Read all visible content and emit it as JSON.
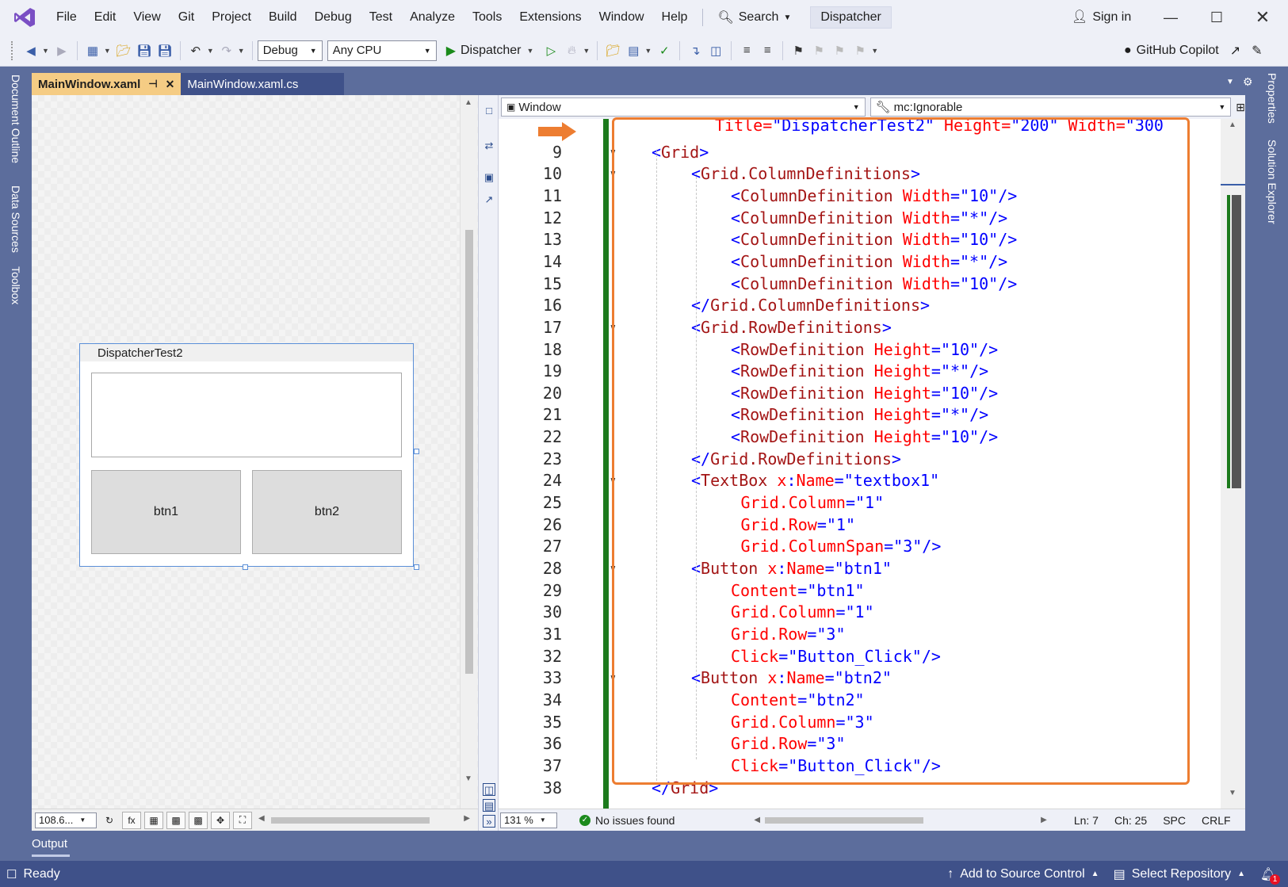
{
  "menu": {
    "items": [
      "File",
      "Edit",
      "View",
      "Git",
      "Project",
      "Build",
      "Debug",
      "Test",
      "Analyze",
      "Tools",
      "Extensions",
      "Window",
      "Help"
    ],
    "search_label": "Search",
    "solution_name": "Dispatcher",
    "sign_in": "Sign in"
  },
  "toolbar": {
    "configuration": "Debug",
    "platform": "Any CPU",
    "run_target": "Dispatcher",
    "copilot": "GitHub Copilot"
  },
  "left_rail": [
    "Document Outline",
    "Data Sources",
    "Toolbox"
  ],
  "right_rail": [
    "Properties",
    "Solution Explorer"
  ],
  "tabs": [
    {
      "label": "MainWindow.xaml",
      "active": true
    },
    {
      "label": "MainWindow.xaml.cs",
      "active": false
    }
  ],
  "designer": {
    "window_title": "DispatcherTest2",
    "buttons": [
      "btn1",
      "btn2"
    ],
    "zoom": "108.6..."
  },
  "editor": {
    "nav_left": "Window",
    "nav_right": "mc:Ignorable",
    "zoom": "131 %",
    "issues": "No issues found",
    "line": "Ln: 7",
    "col": "Ch: 25",
    "whitespace": "SPC",
    "line_ending": "CRLF",
    "first_line_text": "Title=\"DispatcherTest2\" Height=\"200\" Width=\"300",
    "lines": [
      {
        "n": "9",
        "fold": true,
        "indent": 0,
        "parts": [
          [
            "br",
            "<"
          ],
          [
            "tag",
            "Grid"
          ],
          [
            "br",
            ">"
          ]
        ]
      },
      {
        "n": "10",
        "fold": true,
        "indent": 1,
        "parts": [
          [
            "br",
            "<"
          ],
          [
            "tag",
            "Grid.ColumnDefinitions"
          ],
          [
            "br",
            ">"
          ]
        ]
      },
      {
        "n": "11",
        "fold": false,
        "indent": 2,
        "parts": [
          [
            "br",
            "<"
          ],
          [
            "tag",
            "ColumnDefinition"
          ],
          [
            "txt",
            " "
          ],
          [
            "attr",
            "Width"
          ],
          [
            "br",
            "="
          ],
          [
            "val",
            "\"10\""
          ],
          [
            "br",
            "/>"
          ]
        ]
      },
      {
        "n": "12",
        "fold": false,
        "indent": 2,
        "parts": [
          [
            "br",
            "<"
          ],
          [
            "tag",
            "ColumnDefinition"
          ],
          [
            "txt",
            " "
          ],
          [
            "attr",
            "Width"
          ],
          [
            "br",
            "="
          ],
          [
            "val",
            "\"*\""
          ],
          [
            "br",
            "/>"
          ]
        ]
      },
      {
        "n": "13",
        "fold": false,
        "indent": 2,
        "parts": [
          [
            "br",
            "<"
          ],
          [
            "tag",
            "ColumnDefinition"
          ],
          [
            "txt",
            " "
          ],
          [
            "attr",
            "Width"
          ],
          [
            "br",
            "="
          ],
          [
            "val",
            "\"10\""
          ],
          [
            "br",
            "/>"
          ]
        ]
      },
      {
        "n": "14",
        "fold": false,
        "indent": 2,
        "parts": [
          [
            "br",
            "<"
          ],
          [
            "tag",
            "ColumnDefinition"
          ],
          [
            "txt",
            " "
          ],
          [
            "attr",
            "Width"
          ],
          [
            "br",
            "="
          ],
          [
            "val",
            "\"*\""
          ],
          [
            "br",
            "/>"
          ]
        ]
      },
      {
        "n": "15",
        "fold": false,
        "indent": 2,
        "parts": [
          [
            "br",
            "<"
          ],
          [
            "tag",
            "ColumnDefinition"
          ],
          [
            "txt",
            " "
          ],
          [
            "attr",
            "Width"
          ],
          [
            "br",
            "="
          ],
          [
            "val",
            "\"10\""
          ],
          [
            "br",
            "/>"
          ]
        ]
      },
      {
        "n": "16",
        "fold": false,
        "indent": 1,
        "parts": [
          [
            "br",
            "</"
          ],
          [
            "tag",
            "Grid.ColumnDefinitions"
          ],
          [
            "br",
            ">"
          ]
        ]
      },
      {
        "n": "17",
        "fold": true,
        "indent": 1,
        "parts": [
          [
            "br",
            "<"
          ],
          [
            "tag",
            "Grid.RowDefinitions"
          ],
          [
            "br",
            ">"
          ]
        ]
      },
      {
        "n": "18",
        "fold": false,
        "indent": 2,
        "parts": [
          [
            "br",
            "<"
          ],
          [
            "tag",
            "RowDefinition"
          ],
          [
            "txt",
            " "
          ],
          [
            "attr",
            "Height"
          ],
          [
            "br",
            "="
          ],
          [
            "val",
            "\"10\""
          ],
          [
            "br",
            "/>"
          ]
        ]
      },
      {
        "n": "19",
        "fold": false,
        "indent": 2,
        "parts": [
          [
            "br",
            "<"
          ],
          [
            "tag",
            "RowDefinition"
          ],
          [
            "txt",
            " "
          ],
          [
            "attr",
            "Height"
          ],
          [
            "br",
            "="
          ],
          [
            "val",
            "\"*\""
          ],
          [
            "br",
            "/>"
          ]
        ]
      },
      {
        "n": "20",
        "fold": false,
        "indent": 2,
        "parts": [
          [
            "br",
            "<"
          ],
          [
            "tag",
            "RowDefinition"
          ],
          [
            "txt",
            " "
          ],
          [
            "attr",
            "Height"
          ],
          [
            "br",
            "="
          ],
          [
            "val",
            "\"10\""
          ],
          [
            "br",
            "/>"
          ]
        ]
      },
      {
        "n": "21",
        "fold": false,
        "indent": 2,
        "parts": [
          [
            "br",
            "<"
          ],
          [
            "tag",
            "RowDefinition"
          ],
          [
            "txt",
            " "
          ],
          [
            "attr",
            "Height"
          ],
          [
            "br",
            "="
          ],
          [
            "val",
            "\"*\""
          ],
          [
            "br",
            "/>"
          ]
        ]
      },
      {
        "n": "22",
        "fold": false,
        "indent": 2,
        "parts": [
          [
            "br",
            "<"
          ],
          [
            "tag",
            "RowDefinition"
          ],
          [
            "txt",
            " "
          ],
          [
            "attr",
            "Height"
          ],
          [
            "br",
            "="
          ],
          [
            "val",
            "\"10\""
          ],
          [
            "br",
            "/>"
          ]
        ]
      },
      {
        "n": "23",
        "fold": false,
        "indent": 1,
        "parts": [
          [
            "br",
            "</"
          ],
          [
            "tag",
            "Grid.RowDefinitions"
          ],
          [
            "br",
            ">"
          ]
        ]
      },
      {
        "n": "24",
        "fold": true,
        "indent": 1,
        "parts": [
          [
            "br",
            "<"
          ],
          [
            "tag",
            "TextBox"
          ],
          [
            "txt",
            " "
          ],
          [
            "attr",
            "x"
          ],
          [
            "br",
            ":"
          ],
          [
            "attr",
            "Name"
          ],
          [
            "br",
            "="
          ],
          [
            "val",
            "\"textbox1\""
          ]
        ]
      },
      {
        "n": "25",
        "fold": false,
        "indent": 2.25,
        "parts": [
          [
            "attr",
            "Grid.Column"
          ],
          [
            "br",
            "="
          ],
          [
            "val",
            "\"1\""
          ]
        ]
      },
      {
        "n": "26",
        "fold": false,
        "indent": 2.25,
        "parts": [
          [
            "attr",
            "Grid.Row"
          ],
          [
            "br",
            "="
          ],
          [
            "val",
            "\"1\""
          ]
        ]
      },
      {
        "n": "27",
        "fold": false,
        "indent": 2.25,
        "parts": [
          [
            "attr",
            "Grid.ColumnSpan"
          ],
          [
            "br",
            "="
          ],
          [
            "val",
            "\"3\""
          ],
          [
            "br",
            "/>"
          ]
        ]
      },
      {
        "n": "28",
        "fold": true,
        "indent": 1,
        "parts": [
          [
            "br",
            "<"
          ],
          [
            "tag",
            "Button"
          ],
          [
            "txt",
            " "
          ],
          [
            "attr",
            "x"
          ],
          [
            "br",
            ":"
          ],
          [
            "attr",
            "Name"
          ],
          [
            "br",
            "="
          ],
          [
            "val",
            "\"btn1\""
          ]
        ]
      },
      {
        "n": "29",
        "fold": false,
        "indent": 2,
        "parts": [
          [
            "attr",
            "Content"
          ],
          [
            "br",
            "="
          ],
          [
            "val",
            "\"btn1\""
          ]
        ]
      },
      {
        "n": "30",
        "fold": false,
        "indent": 2,
        "parts": [
          [
            "attr",
            "Grid.Column"
          ],
          [
            "br",
            "="
          ],
          [
            "val",
            "\"1\""
          ]
        ]
      },
      {
        "n": "31",
        "fold": false,
        "indent": 2,
        "parts": [
          [
            "attr",
            "Grid.Row"
          ],
          [
            "br",
            "="
          ],
          [
            "val",
            "\"3\""
          ]
        ]
      },
      {
        "n": "32",
        "fold": false,
        "indent": 2,
        "parts": [
          [
            "attr",
            "Click"
          ],
          [
            "br",
            "="
          ],
          [
            "val",
            "\"Button_Click\""
          ],
          [
            "br",
            "/>"
          ]
        ]
      },
      {
        "n": "33",
        "fold": true,
        "indent": 1,
        "parts": [
          [
            "br",
            "<"
          ],
          [
            "tag",
            "Button"
          ],
          [
            "txt",
            " "
          ],
          [
            "attr",
            "x"
          ],
          [
            "br",
            ":"
          ],
          [
            "attr",
            "Name"
          ],
          [
            "br",
            "="
          ],
          [
            "val",
            "\"btn2\""
          ]
        ]
      },
      {
        "n": "34",
        "fold": false,
        "indent": 2,
        "parts": [
          [
            "attr",
            "Content"
          ],
          [
            "br",
            "="
          ],
          [
            "val",
            "\"btn2\""
          ]
        ]
      },
      {
        "n": "35",
        "fold": false,
        "indent": 2,
        "parts": [
          [
            "attr",
            "Grid.Column"
          ],
          [
            "br",
            "="
          ],
          [
            "val",
            "\"3\""
          ]
        ]
      },
      {
        "n": "36",
        "fold": false,
        "indent": 2,
        "parts": [
          [
            "attr",
            "Grid.Row"
          ],
          [
            "br",
            "="
          ],
          [
            "val",
            "\"3\""
          ]
        ]
      },
      {
        "n": "37",
        "fold": false,
        "indent": 2,
        "parts": [
          [
            "attr",
            "Click"
          ],
          [
            "br",
            "="
          ],
          [
            "val",
            "\"Button_Click\""
          ],
          [
            "br",
            "/>"
          ]
        ]
      },
      {
        "n": "38",
        "fold": false,
        "indent": 0,
        "parts": [
          [
            "br",
            "</"
          ],
          [
            "tag",
            "Grid"
          ],
          [
            "br",
            ">"
          ]
        ]
      }
    ]
  },
  "output_tab": "Output",
  "status": {
    "ready": "Ready",
    "add_source_control": "Add to Source Control",
    "select_repository": "Select Repository",
    "notifications": "1"
  },
  "colors": {
    "accent": "#5c6d9c",
    "highlight": "#ed7d31",
    "changes_bar": "#1c7a1c"
  }
}
